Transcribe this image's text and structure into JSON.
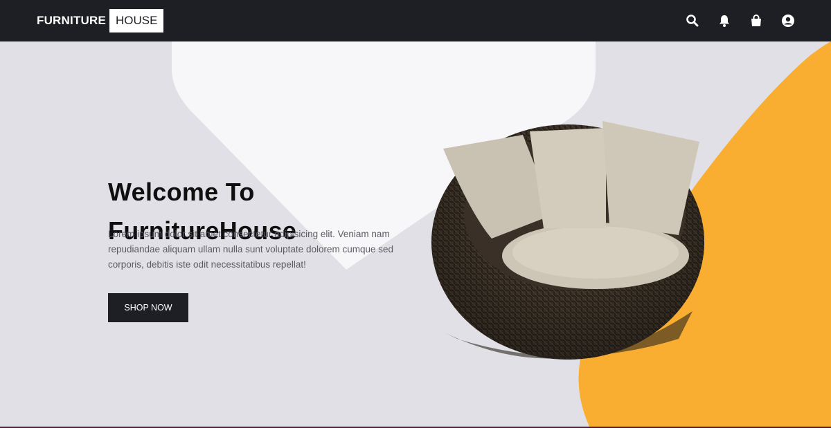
{
  "nav": {
    "logo_part1": "FURNITURE",
    "logo_part2": "HOUSE",
    "icons": [
      "search-icon",
      "bell-icon",
      "shopping-bag-icon",
      "user-circle-icon"
    ]
  },
  "hero": {
    "title_line1": "Welcome  To",
    "title_line2": "FurnitureHouse",
    "description": "Lorem ipsum dolor sit amet consectetur adipisicing elit. Veniam nam repudiandae aliquam ullam nulla sunt voluptate dolorem cumque sed corporis, debitis iste odit necessitatibus repellat!",
    "cta_label": "SHOP NOW"
  },
  "colors": {
    "nav_bg": "#1e1f24",
    "hero_bg": "#e1e0e6",
    "accent": "#f9ae32",
    "shape_white": "#f7f7f9"
  }
}
